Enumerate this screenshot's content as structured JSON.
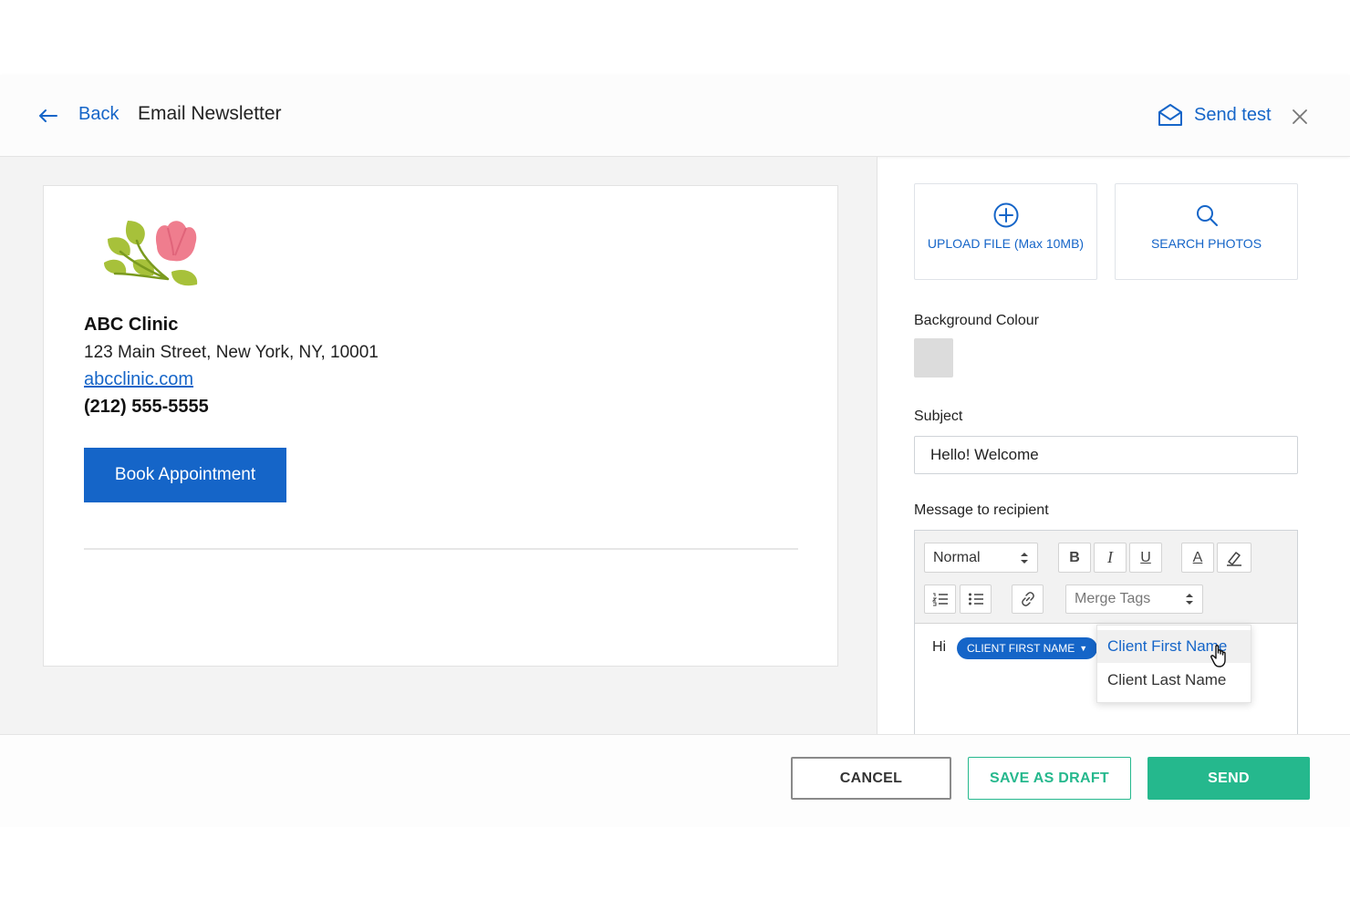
{
  "header": {
    "back_label": "Back",
    "title": "Email Newsletter",
    "send_test_label": "Send test"
  },
  "preview": {
    "clinic_name": "ABC Clinic",
    "address": "123 Main Street, New York, NY, 10001",
    "website": "abcclinic.com",
    "phone": "(212) 555-5555",
    "book_button": "Book Appointment"
  },
  "sidebar": {
    "upload_label": "UPLOAD FILE (Max 10MB)",
    "search_photos_label": "SEARCH PHOTOS",
    "background_colour_label": "Background Colour",
    "background_colour_value": "#dcdcdc",
    "subject_label": "Subject",
    "subject_value": "Hello! Welcome",
    "message_label": "Message to recipient"
  },
  "editor": {
    "format_select": "Normal",
    "bold_glyph": "B",
    "italic_glyph": "I",
    "underline_glyph": "U",
    "text_color_glyph": "A",
    "merge_tags_select": "Merge Tags",
    "body_text": "Hi",
    "merge_pill": "CLIENT FIRST NAME",
    "dropdown_options": [
      "Client First Name",
      "Client Last Name"
    ]
  },
  "footer": {
    "cancel": "CANCEL",
    "save_draft": "SAVE AS DRAFT",
    "send": "SEND"
  },
  "colors": {
    "accent_blue": "#1565c8",
    "send_green": "#25b88d"
  }
}
